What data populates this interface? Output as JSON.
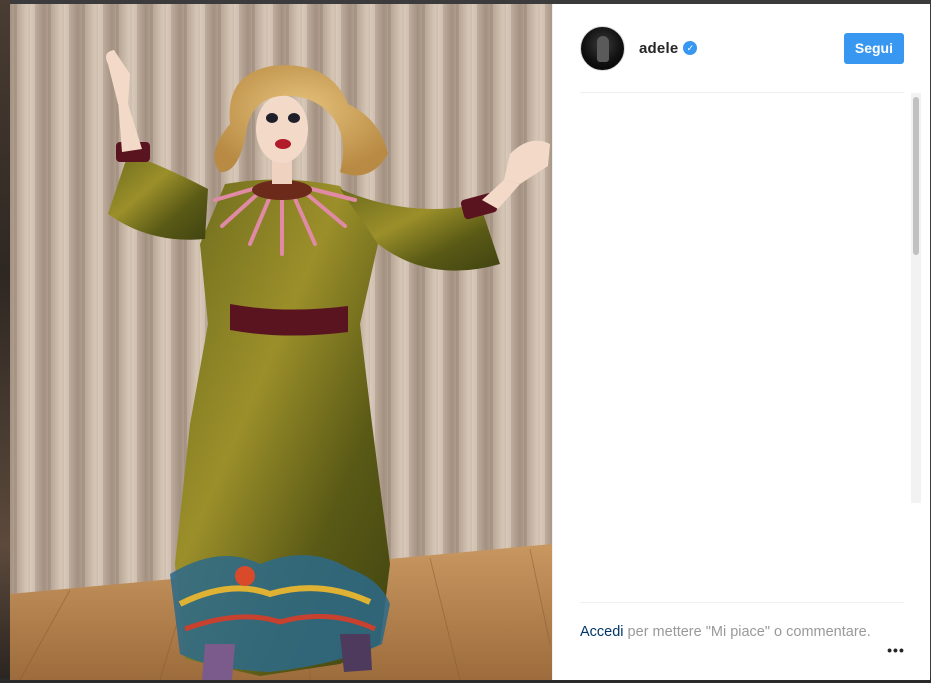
{
  "header": {
    "username": "adele",
    "follow_label": "Segui"
  },
  "footer": {
    "login_label": "Accedi",
    "cta_text": " per mettere \"Mi piace\" o commentare.",
    "more_label": "•••"
  },
  "colors": {
    "accent": "#3897f0",
    "link": "#003569",
    "muted_text": "#999999",
    "username": "#262626"
  },
  "icons": [
    "verified-badge-icon",
    "more-options-icon"
  ]
}
